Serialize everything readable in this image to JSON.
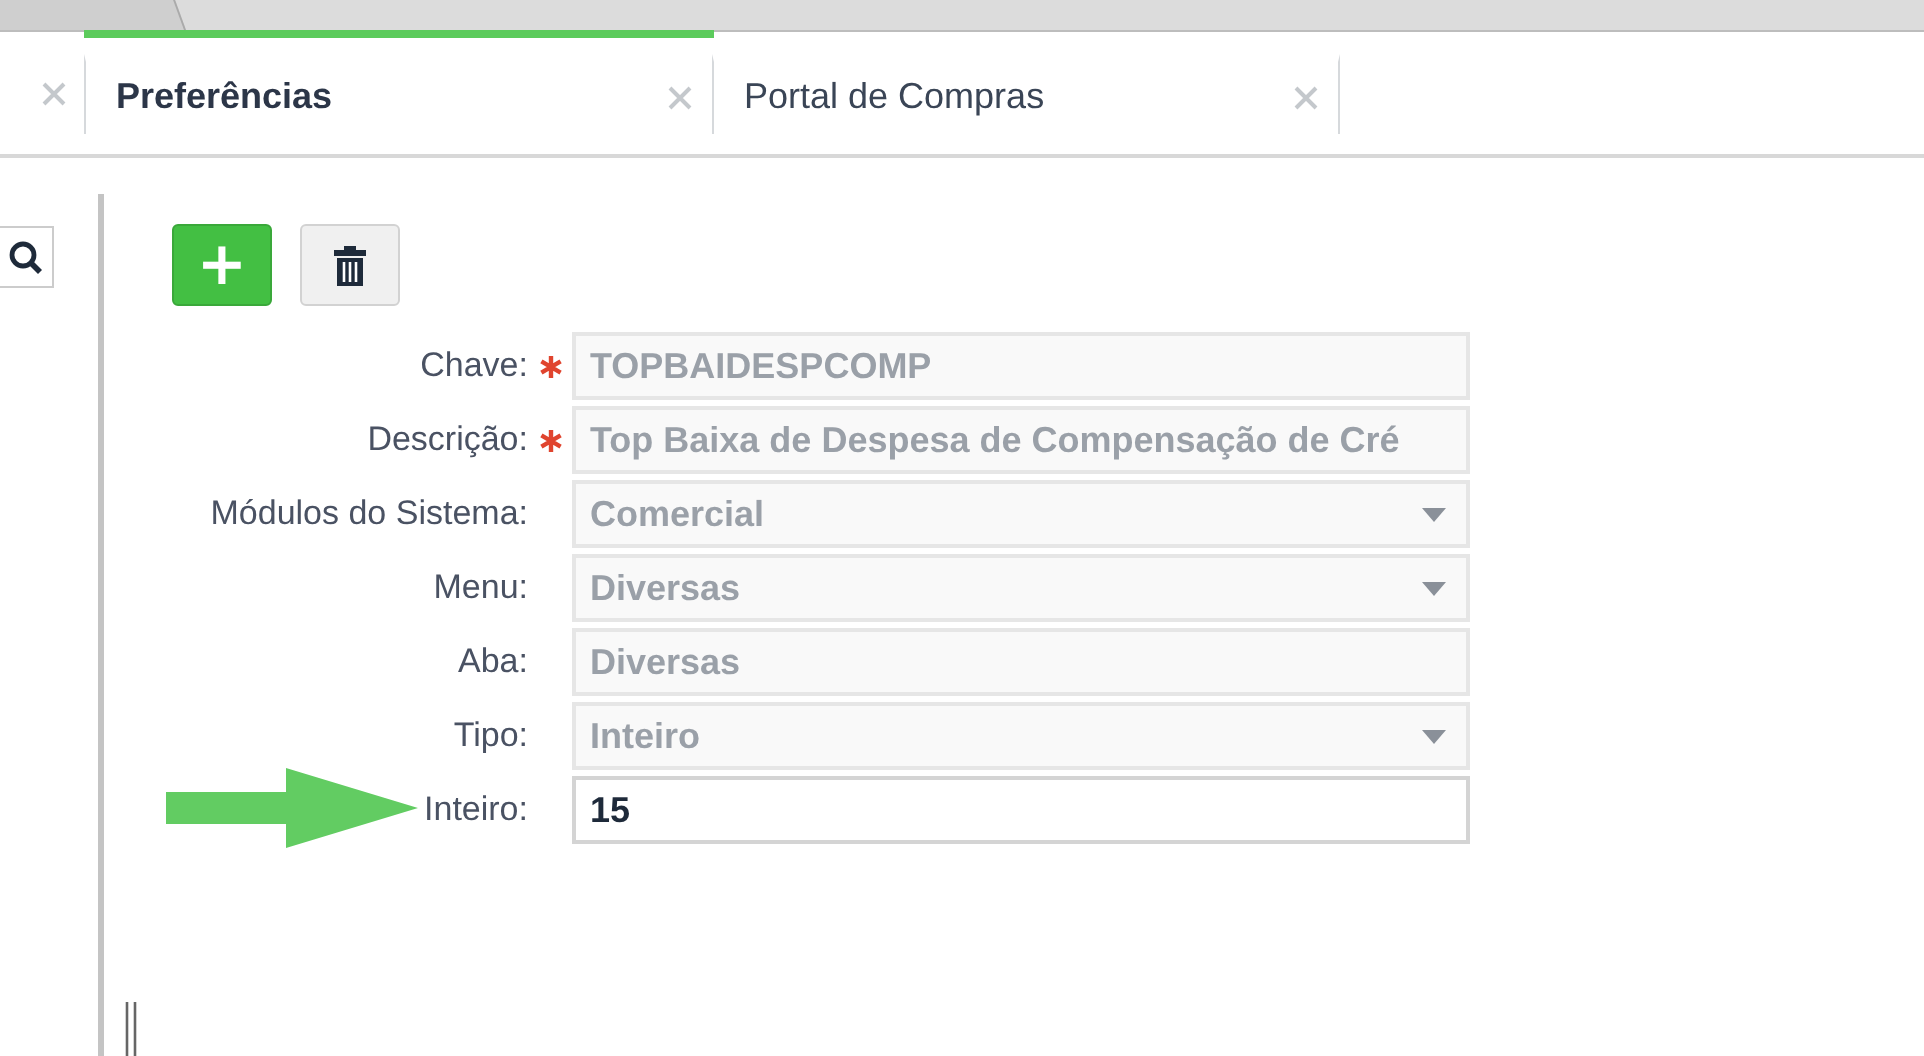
{
  "tabs": [
    {
      "label": "Preferências",
      "selected": true
    },
    {
      "label": "Portal de Compras",
      "selected": false
    }
  ],
  "toolbar": {
    "add": "+"
  },
  "fields": [
    {
      "label": "Chave:",
      "required": true,
      "kind": "text",
      "value": "TOPBAIDESPCOMP",
      "disabled": true
    },
    {
      "label": "Descrição:",
      "required": true,
      "kind": "text",
      "value": "Top Baixa de Despesa de Compensação de Cré",
      "disabled": true
    },
    {
      "label": "Módulos do Sistema:",
      "required": false,
      "kind": "select",
      "value": "Comercial",
      "disabled": true
    },
    {
      "label": "Menu:",
      "required": false,
      "kind": "select",
      "value": "Diversas",
      "disabled": true
    },
    {
      "label": "Aba:",
      "required": false,
      "kind": "text",
      "value": "Diversas",
      "disabled": true
    },
    {
      "label": "Tipo:",
      "required": false,
      "kind": "select",
      "value": "Inteiro",
      "disabled": true
    },
    {
      "label": "Inteiro:",
      "required": false,
      "kind": "text",
      "value": "15",
      "disabled": false
    }
  ]
}
